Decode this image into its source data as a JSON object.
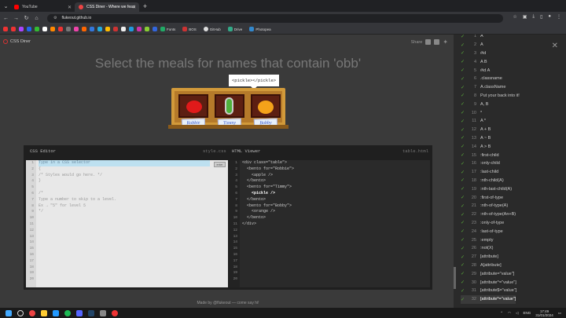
{
  "browser": {
    "tabs": [
      {
        "label": "YouTube",
        "color": "#ff0000"
      },
      {
        "label": "CSS Diner - Where we feast on CSS",
        "color": "#e44"
      }
    ],
    "url": "flukeout.github.io",
    "bookmarks": [
      {
        "label": "Fonts",
        "color": "#2a6"
      },
      {
        "label": "BOS",
        "color": "#c33"
      },
      {
        "label": "GitHub",
        "color": "#ddd"
      },
      {
        "label": "Drive",
        "color": "#3a8"
      },
      {
        "label": "Photopea",
        "color": "#38c"
      }
    ]
  },
  "site": {
    "logo": "CSS Diner",
    "share": "Share",
    "headline": "Select the meals for names that contain 'obb'",
    "tooltip": "<pickle></pickle>",
    "names": [
      "Robbie",
      "Timmy",
      "Bobby"
    ]
  },
  "css_editor": {
    "title": "CSS Editor",
    "file": "style.css",
    "enter": "enter",
    "line_numbers": [
      "1",
      "2",
      "3",
      "4",
      "5",
      "6",
      "7",
      "8",
      "9",
      "10",
      "11",
      "12",
      "13",
      "14",
      "15",
      "16",
      "17",
      "18",
      "19",
      "20"
    ],
    "lines": [
      "Type in a CSS selector",
      "{",
      "/* Styles would go here. */",
      "}",
      "",
      "/*",
      "Type a number to skip to a level.",
      "Ex → \"5\" for level 5",
      "*/"
    ]
  },
  "html_viewer": {
    "title": "HTML Viewer",
    "file": "table.html",
    "line_numbers": [
      "1",
      "2",
      "3",
      "4",
      "5",
      "6",
      "7",
      "8",
      "9",
      "10",
      "11",
      "12",
      "13",
      "14",
      "15",
      "16",
      "17",
      "18",
      "19",
      "20"
    ],
    "lines": [
      "<div class=\"table\">",
      "  <bento for=\"Robbie\">",
      "    <apple />",
      "  </bento>",
      "  <bento for=\"Timmy\">",
      "    <pickle />",
      "  </bento>",
      "  <bento for=\"Bobby\">",
      "    <orange />",
      "  </bento>",
      "</div>"
    ]
  },
  "footer": "Made by @flukeout — come say hi!",
  "levels": [
    {
      "n": "1",
      "label": "A"
    },
    {
      "n": "2",
      "label": "A"
    },
    {
      "n": "3",
      "label": "#id"
    },
    {
      "n": "4",
      "label": "A  B"
    },
    {
      "n": "5",
      "label": "#id  A"
    },
    {
      "n": "6",
      "label": ".classname"
    },
    {
      "n": "7",
      "label": "A.className"
    },
    {
      "n": "8",
      "label": "Put your back into it!"
    },
    {
      "n": "9",
      "label": "A, B"
    },
    {
      "n": "10",
      "label": "*"
    },
    {
      "n": "11",
      "label": "A  *"
    },
    {
      "n": "12",
      "label": "A + B"
    },
    {
      "n": "13",
      "label": "A ~ B"
    },
    {
      "n": "14",
      "label": "A > B"
    },
    {
      "n": "15",
      "label": ":first-child"
    },
    {
      "n": "16",
      "label": ":only-child"
    },
    {
      "n": "17",
      "label": ":last-child"
    },
    {
      "n": "18",
      "label": ":nth-child(A)"
    },
    {
      "n": "19",
      "label": ":nth-last-child(A)"
    },
    {
      "n": "20",
      "label": ":first-of-type"
    },
    {
      "n": "21",
      "label": ":nth-of-type(A)"
    },
    {
      "n": "22",
      "label": ":nth-of-type(An+B)"
    },
    {
      "n": "23",
      "label": ":only-of-type"
    },
    {
      "n": "24",
      "label": ":last-of-type"
    },
    {
      "n": "25",
      "label": ":empty"
    },
    {
      "n": "26",
      "label": ":not(X)"
    },
    {
      "n": "27",
      "label": "[attribute]"
    },
    {
      "n": "28",
      "label": "A[attribute]"
    },
    {
      "n": "29",
      "label": "[attribute=\"value\"]"
    },
    {
      "n": "30",
      "label": "[attribute^=\"value\"]"
    },
    {
      "n": "31",
      "label": "[attribute$=\"value\"]"
    },
    {
      "n": "32",
      "label": "[attribute*=\"value\"]"
    }
  ],
  "taskbar": {
    "lang": "ENG",
    "time": "17:49",
    "date": "31/01/2024"
  }
}
